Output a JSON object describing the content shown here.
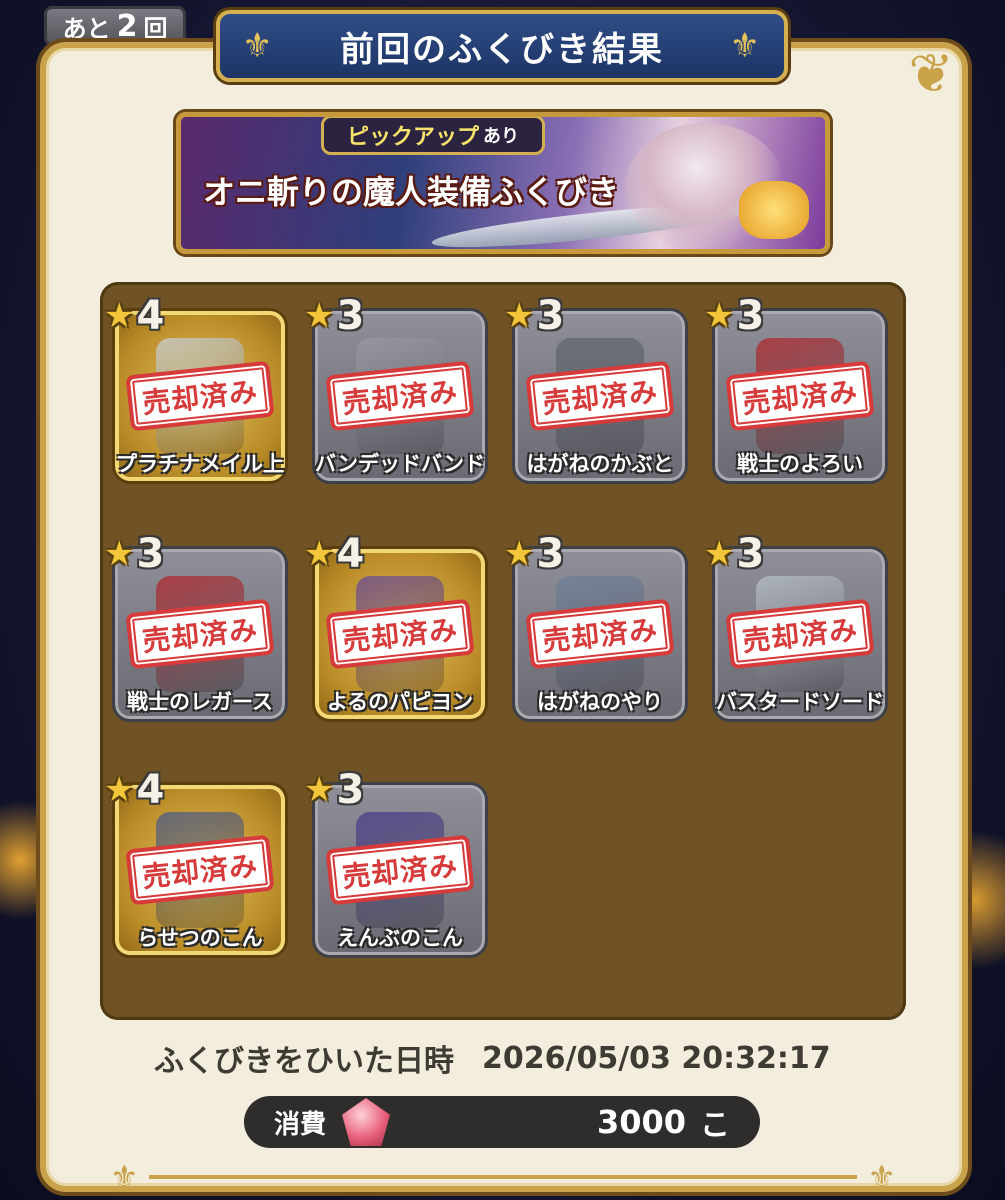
{
  "remaining": {
    "prefix": "あと",
    "count": "2",
    "suffix": "回"
  },
  "title": "前回のふくびき結果",
  "banner": {
    "tag_highlight": "ピックアップ",
    "tag_suffix": "あり",
    "title": "オニ斬りの魔人装備ふくびき"
  },
  "sold_label": "売却済み",
  "items": [
    {
      "stars": "4",
      "name": "プラチナメイル上",
      "gold": true,
      "icon": "armor-icon",
      "color": "#c9d2da"
    },
    {
      "stars": "3",
      "name": "バンデッドバンド",
      "gold": false,
      "icon": "headband-icon",
      "color": "#9a9aa4"
    },
    {
      "stars": "3",
      "name": "はがねのかぶと",
      "gold": false,
      "icon": "helmet-icon",
      "color": "#5f666e"
    },
    {
      "stars": "3",
      "name": "戦士のよろい",
      "gold": false,
      "icon": "armor-icon",
      "color": "#b3262b"
    },
    {
      "stars": "3",
      "name": "戦士のレガース",
      "gold": false,
      "icon": "legs-icon",
      "color": "#b3262b"
    },
    {
      "stars": "4",
      "name": "よるのパピヨン",
      "gold": true,
      "icon": "blade-icon",
      "color": "#6a4a9a"
    },
    {
      "stars": "3",
      "name": "はがねのやり",
      "gold": false,
      "icon": "spear-icon",
      "color": "#6f7f9a"
    },
    {
      "stars": "3",
      "name": "バスタードソード",
      "gold": false,
      "icon": "sword-icon",
      "color": "#b9c1c9"
    },
    {
      "stars": "4",
      "name": "らせつのこん",
      "gold": true,
      "icon": "staff-icon",
      "color": "#4a5a8a"
    },
    {
      "stars": "3",
      "name": "えんぶのこん",
      "gold": false,
      "icon": "staff-icon",
      "color": "#4a3a8a"
    }
  ],
  "drawn_time": {
    "label": "ふくびきをひいた日時",
    "value": "2026/05/03 20:32:17"
  },
  "cost": {
    "label": "消費",
    "amount": "3000",
    "unit": "こ",
    "icon": "gem-icon"
  }
}
